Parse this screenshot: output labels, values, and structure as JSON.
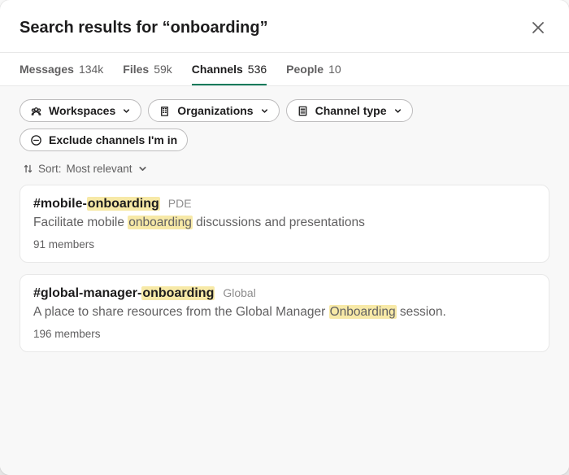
{
  "header": {
    "title_prefix": "Search results for ",
    "query_quoted": "“onboarding”",
    "highlight_token": "onboarding"
  },
  "tabs": [
    {
      "id": "messages",
      "label": "Messages",
      "count": "134k",
      "active": false
    },
    {
      "id": "files",
      "label": "Files",
      "count": "59k",
      "active": false
    },
    {
      "id": "channels",
      "label": "Channels",
      "count": "536",
      "active": true
    },
    {
      "id": "people",
      "label": "People",
      "count": "10",
      "active": false
    }
  ],
  "filters": [
    {
      "id": "workspaces",
      "label": "Workspaces",
      "icon": "workspaces-icon",
      "chevron": true
    },
    {
      "id": "organizations",
      "label": "Organizations",
      "icon": "building-icon",
      "chevron": true
    },
    {
      "id": "channel_type",
      "label": "Channel type",
      "icon": "list-icon",
      "chevron": true
    },
    {
      "id": "exclude_mine",
      "label": "Exclude channels I'm in",
      "icon": "minus-circle-icon",
      "chevron": false
    }
  ],
  "sort": {
    "prefix": "Sort: ",
    "value": "Most relevant"
  },
  "results": [
    {
      "name": "#mobile-onboarding",
      "org": "PDE",
      "description": "Facilitate mobile onboarding discussions and presentations",
      "members": "91 members"
    },
    {
      "name": "#global-manager-onboarding",
      "org": "Global",
      "description": "A place to share resources from the Global Manager Onboarding session.",
      "members": "196 members"
    }
  ]
}
